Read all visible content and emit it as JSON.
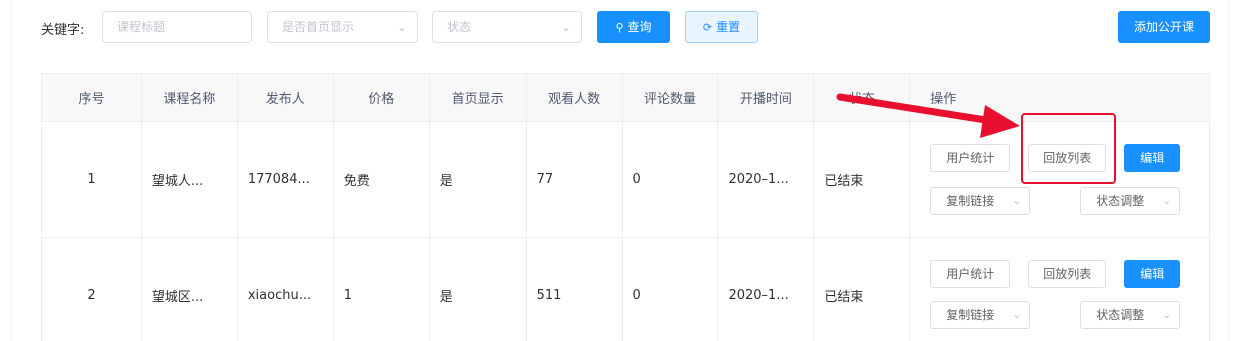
{
  "filter": {
    "label": "关键字:",
    "title_placeholder": "课程标题",
    "homepage_placeholder": "是否首页显示",
    "status_placeholder": "状态",
    "search_label": "查询",
    "reset_label": "重置",
    "add_label": "添加公开课"
  },
  "table": {
    "headers": [
      "序号",
      "课程名称",
      "发布人",
      "价格",
      "首页显示",
      "观看人数",
      "评论数量",
      "开播时间",
      "状态",
      "操作"
    ],
    "rows": [
      {
        "index": "1",
        "name": "望城人...",
        "publisher": "177084...",
        "price": "免费",
        "homepage": "是",
        "viewers": "77",
        "comments": "0",
        "time": "2020–1...",
        "status": "已结束"
      },
      {
        "index": "2",
        "name": "望城区...",
        "publisher": "xiaochu...",
        "price": "1",
        "homepage": "是",
        "viewers": "511",
        "comments": "0",
        "time": "2020–1...",
        "status": "已结束"
      }
    ],
    "ops": {
      "user_stats": "用户统计",
      "replay_list": "回放列表",
      "edit": "编辑",
      "copy_link": "复制链接",
      "status_adjust": "状态调整"
    }
  },
  "annotation": {
    "color": "#e8102e"
  }
}
